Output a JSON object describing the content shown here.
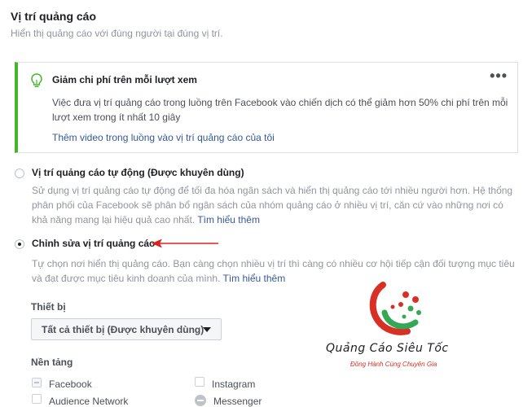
{
  "header": {
    "title": "Vị trí quảng cáo",
    "subtitle": "Hiển thị quảng cáo với đúng người tại đúng vị trí."
  },
  "tip": {
    "icon": "lightbulb-icon",
    "title": "Giảm chi phí trên mỗi lượt xem",
    "more_icon": "•••",
    "body": "Việc đưa vị trí quảng cáo trong luồng trên Facebook vào chiến dịch có thể giảm hơn 50% chi phí trên mỗi lượt xem trong ít nhất 10 giây",
    "link": "Thêm video trong luồng vào vị trí quảng cáo của tôi",
    "accent_color": "#42b72a"
  },
  "options": [
    {
      "label": "Vị trí quảng cáo tự động (Được khuyên dùng)",
      "description": "Sử dụng vị trí quảng cáo tự động để tối đa hóa ngân sách và hiển thị quảng cáo tới nhiều người hơn. Hệ thống phân phối của Facebook sẽ phân bổ ngân sách của nhóm quảng cáo ở nhiều vị trí, căn cứ vào những nơi có khả năng mang lại hiệu quả cao nhất.",
      "link": "Tìm hiểu thêm",
      "selected": false
    },
    {
      "label": "Chỉnh sửa vị trí quảng cáo",
      "description": "Tự chọn nơi hiển thị quảng cáo. Bạn càng chọn nhiều vị trí thì càng có nhiều cơ hội tiếp cận đối tượng mục tiêu và đạt được mục tiêu kinh doanh của mình.",
      "link": "Tìm hiểu thêm",
      "selected": true
    }
  ],
  "devices": {
    "label": "Thiết bị",
    "selected": "Tất cả thiết bị (Được khuyên dùng)"
  },
  "platforms": {
    "label": "Nền tảng",
    "items": [
      {
        "name": "Facebook",
        "state": "mixed"
      },
      {
        "name": "Instagram",
        "state": "unchecked"
      },
      {
        "name": "Audience Network",
        "state": "unchecked"
      },
      {
        "name": "Messenger",
        "state": "mixed"
      }
    ]
  },
  "annotation": {
    "arrow_color": "#e02020"
  },
  "watermark": {
    "brand": "Quảng Cáo Siêu Tốc",
    "slogan": "Đồng Hành Cùng Chuyên Gia",
    "logo_colors": [
      "#d93025",
      "#34a853"
    ]
  }
}
